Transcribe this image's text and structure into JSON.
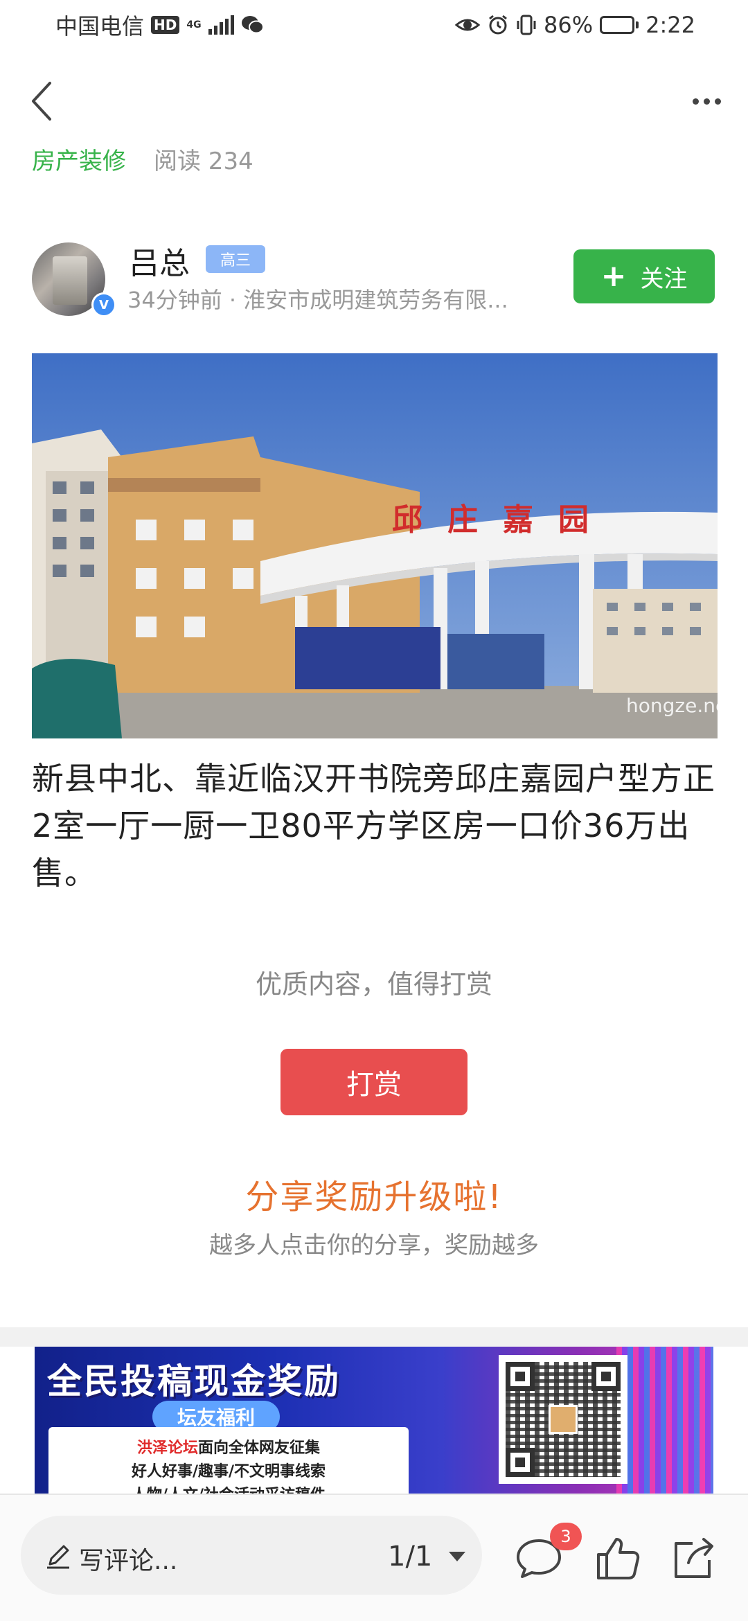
{
  "status_bar": {
    "carrier": "中国电信",
    "hd_label": "HD",
    "network_type": "4G",
    "battery_percent": "86%",
    "battery_level": 0.86,
    "time": "2:22",
    "icons": [
      "wechat-icon",
      "eye-icon",
      "alarm-icon",
      "vibrate-icon",
      "battery-icon"
    ]
  },
  "nav": {
    "back_icon": "chevron-left-icon",
    "more_icon": "more-dots-icon"
  },
  "post_meta": {
    "category": "房产装修",
    "read_label": "阅读 234"
  },
  "author": {
    "name": "吕总",
    "level_badge": "高三",
    "verified_mark": "V",
    "subline": "34分钟前 · 淮安市成明建筑劳务有限...",
    "follow_label": "关注",
    "follow_icon": "plus-icon"
  },
  "photo": {
    "gate_sign": "邱庄嘉园",
    "watermark": "hongze.net",
    "colors": {
      "sky": "#4b78c7",
      "building": "#d9a867"
    }
  },
  "post_title": "新县中北、靠近临汉开书院旁邱庄嘉园户型方正2室一厅一厨一卫80平方学区房一口价36万出售。",
  "reward": {
    "tip": "优质内容，值得打赏",
    "button_label": "打赏"
  },
  "share": {
    "title": "分享奖励升级啦!",
    "subtitle": "越多人点击你的分享，奖励越多"
  },
  "banner": {
    "title": "全民投稿现金奖励",
    "tag": "坛友福利",
    "line1_red": "洪泽论坛",
    "line1_rest": "面向全体网友征集",
    "line2": "好人好事/趣事/不文明事线索",
    "line3": "人物/人文/社会活动采访稿件"
  },
  "bottom_bar": {
    "comment_placeholder": "写评论...",
    "page_indicator": "1/1",
    "comment_count": "3",
    "icons": [
      "pen-icon",
      "comment-icon",
      "like-icon",
      "share-icon"
    ]
  },
  "colors": {
    "accent_green": "#37b34a",
    "reward_red": "#e84e4f",
    "share_orange": "#e6722f",
    "badge_blue": "#8cb6f7",
    "verified_blue": "#3f8ef5"
  }
}
